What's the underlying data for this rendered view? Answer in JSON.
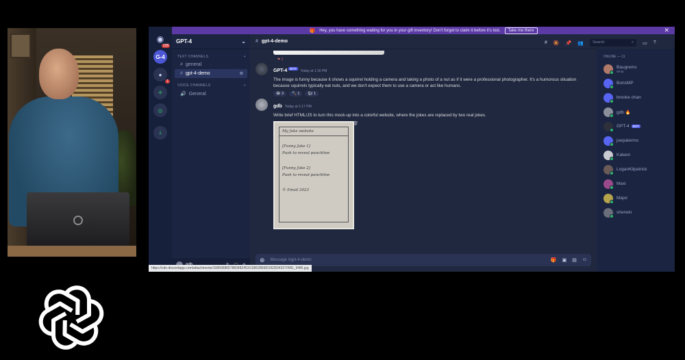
{
  "banner": {
    "text": "Hey, you have something waiting for you in your gift inventory! Don't forget to claim it before it's lost.",
    "button": "Take me there",
    "close": "✕"
  },
  "rail": {
    "notification_count": "128",
    "gpt_label": "G-4",
    "second_badge": "1"
  },
  "guild": {
    "name": "GPT-4"
  },
  "channels": {
    "text_category": "TEXT CHANNELS",
    "voice_category": "VOICE CHANNELS",
    "text": [
      "general",
      "gpt-4-demo"
    ],
    "voice": [
      "General"
    ]
  },
  "user_bar": {
    "name": "gdb"
  },
  "chat": {
    "channel": "gpt-4-demo",
    "top_reaction": "❤ 1",
    "messages": [
      {
        "author": "GPT-4",
        "bot_tag": "BOT",
        "time": "Today at 1:16 PM",
        "text": "The image is funny because it shows a squirrel holding a camera and taking a photo of a nut as if it were a professional photographer. It's a humorous situation because squirrels typically eat nuts, and we don't expect them to use a camera or act like humans.",
        "reactions": [
          "😂 3",
          "🔨 1",
          "🐿 1"
        ]
      },
      {
        "author": "gdb",
        "time": "Today at 1:17 PM",
        "text": "Write brief HTML/JS to turn this mock-up into a colorful website, where the jokes are replaced by two real jokes.",
        "sketch": {
          "title": "My Joke website",
          "lines": [
            "[Funny Joke 1]",
            "Push to reveal punchline",
            "[Funny Joke 2]",
            "Push to reveal punchline",
            "© Email 2023"
          ]
        }
      }
    ],
    "composer_placeholder": "Message #gpt-4-demo"
  },
  "toolbar": {
    "search_placeholder": "Search"
  },
  "members": {
    "category": "ONLINE — 11",
    "list": [
      {
        "name": "Baugrems",
        "sub": "What",
        "color": "#b07a6a"
      },
      {
        "name": "BorisMP",
        "sub": "",
        "color": "#5865f2"
      },
      {
        "name": "brooke chan",
        "sub": "",
        "color": "#5865f2"
      },
      {
        "name": "gdb 🔥",
        "sub": "",
        "color": "#8a8f99"
      },
      {
        "name": "GPT-4",
        "sub": "",
        "bot": "BOT",
        "color": "#2d2f3a"
      },
      {
        "name": "joepalermo",
        "sub": "",
        "color": "#5865f2"
      },
      {
        "name": "Kaleen",
        "sub": "",
        "color": "#c9c9d0"
      },
      {
        "name": "LoganKilpatrick",
        "sub": "",
        "color": "#6a5a58"
      },
      {
        "name": "Maxi",
        "sub": "",
        "color": "#9a4a8a"
      },
      {
        "name": "Major",
        "sub": "",
        "color": "#b5a44c"
      },
      {
        "name": "sherwin",
        "sub": "",
        "color": "#6a6e7a"
      }
    ]
  },
  "url_status": "https://cdn.discordapp.com/attachments/1085068657883482453/1085286681062834337/IMG_9485.jpg"
}
